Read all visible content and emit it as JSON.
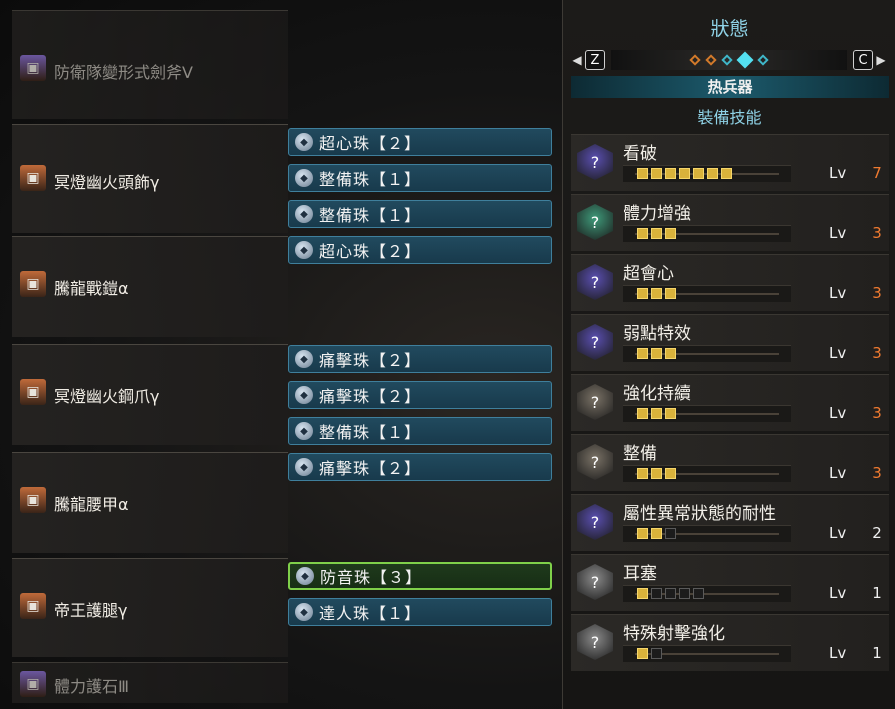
{
  "equipment": [
    {
      "name": "防衛隊變形式劍斧Ⅴ",
      "icon_color": "#8a6fd0",
      "icon": "weapon-icon",
      "dim": true,
      "decorations": []
    },
    {
      "name": "冥燈幽火頭飾γ",
      "icon_color": "#c06a3a",
      "icon": "helm-icon",
      "dim": false,
      "decorations": [
        {
          "name": "超心珠【２】",
          "green": false
        },
        {
          "name": "整備珠【１】",
          "green": false
        },
        {
          "name": "整備珠【１】",
          "green": false
        }
      ]
    },
    {
      "name": "騰龍戰鎧α",
      "icon_color": "#c06a3a",
      "icon": "chest-icon",
      "dim": false,
      "decorations": [
        {
          "name": "超心珠【２】",
          "green": false
        }
      ]
    },
    {
      "name": "冥燈幽火鋼爪γ",
      "icon_color": "#c06a3a",
      "icon": "arms-icon",
      "dim": false,
      "decorations": [
        {
          "name": "痛擊珠【２】",
          "green": false
        },
        {
          "name": "痛擊珠【２】",
          "green": false
        },
        {
          "name": "整備珠【１】",
          "green": false
        }
      ]
    },
    {
      "name": "騰龍腰甲α",
      "icon_color": "#c06a3a",
      "icon": "waist-icon",
      "dim": false,
      "decorations": [
        {
          "name": "痛擊珠【２】",
          "green": false
        }
      ]
    },
    {
      "name": "帝王護腿γ",
      "icon_color": "#c06a3a",
      "icon": "legs-icon",
      "dim": false,
      "decorations": [
        {
          "name": "防音珠【３】",
          "green": true
        },
        {
          "name": "達人珠【１】",
          "green": false
        }
      ]
    },
    {
      "name": "體力護石Ⅲ",
      "icon_color": "#8a6fd0",
      "icon": "charm-icon",
      "dim": true,
      "decorations": []
    }
  ],
  "status": {
    "title": "狀態",
    "key_left": "Z",
    "key_right": "C",
    "dots": [
      "#d27a2a",
      "#d27a2a",
      "#3fb7c9",
      "#54e0f0",
      "#3fb7c9"
    ],
    "active_dot": 3,
    "tab_label": "热兵器",
    "section_heading": "裝備技能",
    "lv_label": "Lv",
    "skills": [
      {
        "name": "看破",
        "level": 7,
        "max": 7,
        "icon_color": "#5a4fb0",
        "maxed": true
      },
      {
        "name": "體力增強",
        "level": 3,
        "max": 3,
        "icon_color": "#3f9a7a",
        "maxed": true
      },
      {
        "name": "超會心",
        "level": 3,
        "max": 3,
        "icon_color": "#5a4fb0",
        "maxed": true
      },
      {
        "name": "弱點特效",
        "level": 3,
        "max": 3,
        "icon_color": "#5a4fb0",
        "maxed": true
      },
      {
        "name": "強化持續",
        "level": 3,
        "max": 3,
        "icon_color": "#7a7266",
        "maxed": true
      },
      {
        "name": "整備",
        "level": 3,
        "max": 3,
        "icon_color": "#7a7266",
        "maxed": true
      },
      {
        "name": "屬性異常狀態的耐性",
        "level": 2,
        "max": 3,
        "icon_color": "#5a4fb0",
        "maxed": false
      },
      {
        "name": "耳塞",
        "level": 1,
        "max": 5,
        "icon_color": "#8a8a8a",
        "maxed": false
      },
      {
        "name": "特殊射擊強化",
        "level": 1,
        "max": 2,
        "icon_color": "#8a8a8a",
        "maxed": false
      }
    ]
  }
}
